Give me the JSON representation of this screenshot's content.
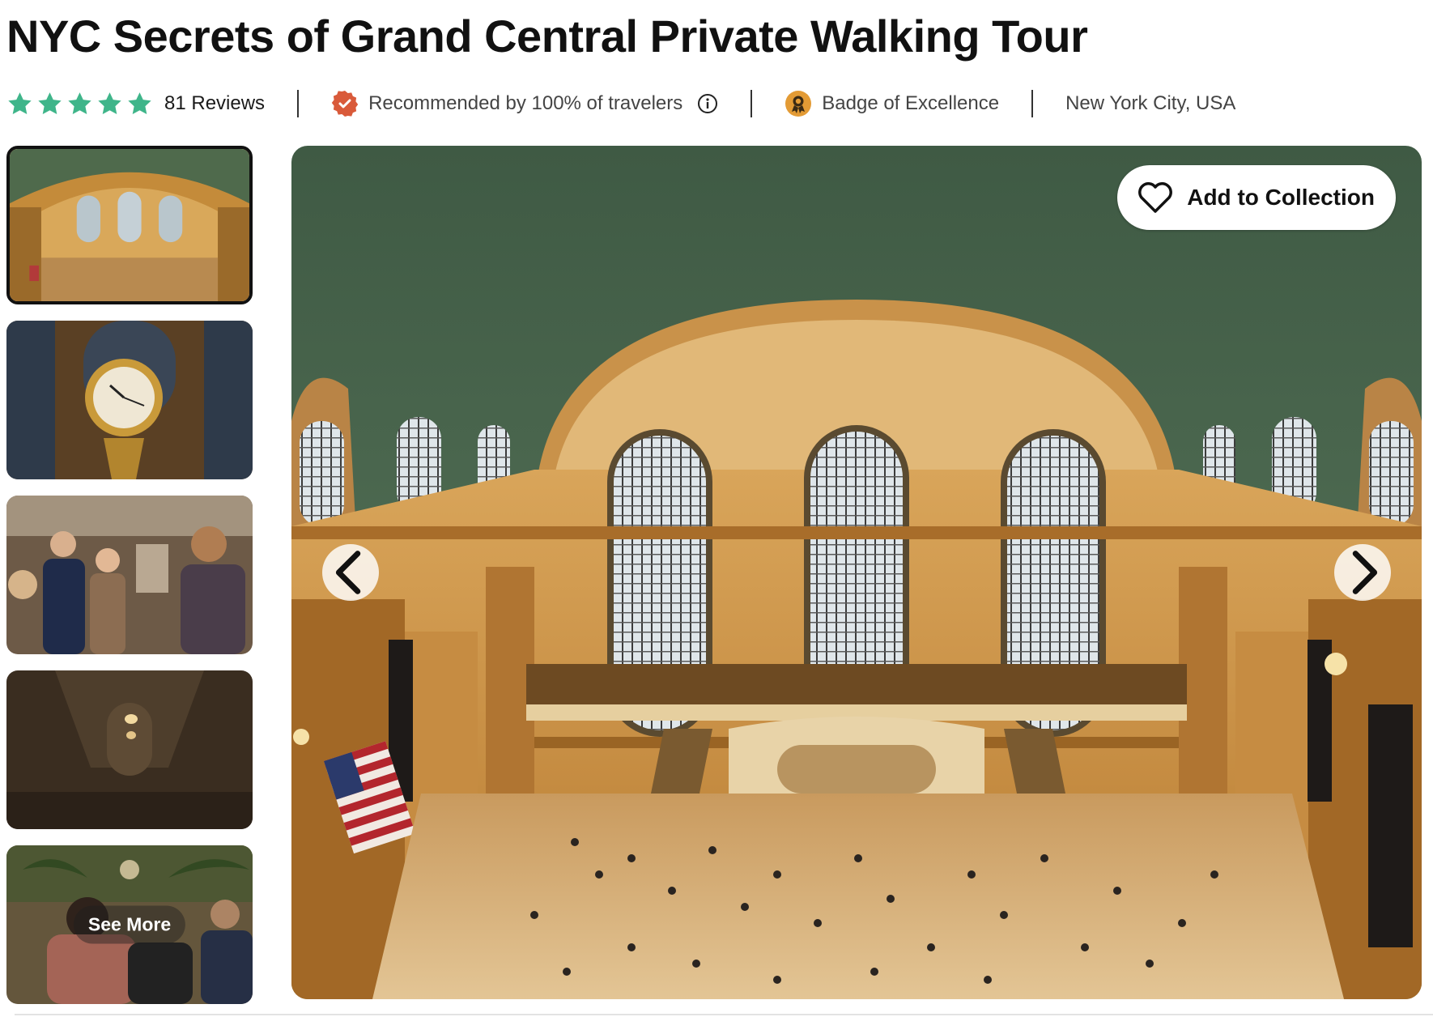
{
  "page": {
    "title": "NYC Secrets of Grand Central Private Walking Tour"
  },
  "rating": {
    "stars": 5,
    "max_stars": 5,
    "reviews_label": "81 Reviews",
    "star_color": "#3fb58a"
  },
  "recommendation": {
    "label": "Recommended by 100% of travelers",
    "icon": "verified-badge-icon",
    "icon_color": "#d95a3a"
  },
  "badge": {
    "label": "Badge of Excellence",
    "icon": "award-badge-icon",
    "icon_color": "#d98a2a"
  },
  "location": {
    "label": "New York City, USA"
  },
  "gallery": {
    "thumbnails": [
      {
        "name": "grand-central-main-concourse",
        "active": true
      },
      {
        "name": "grand-central-clock",
        "active": false
      },
      {
        "name": "tour-group-guide",
        "active": false
      },
      {
        "name": "whispering-gallery",
        "active": false
      },
      {
        "name": "vanderbilt-hall",
        "active": false
      }
    ],
    "see_more_label": "See More",
    "add_to_collection_label": "Add to Collection"
  }
}
